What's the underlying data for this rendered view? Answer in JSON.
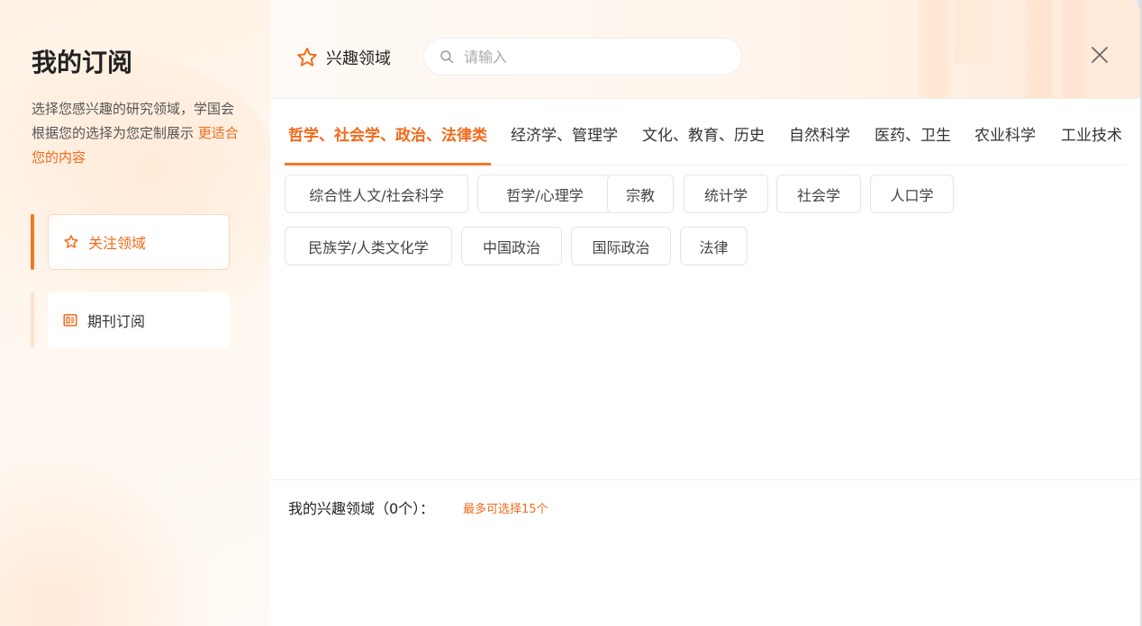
{
  "sidebar": {
    "title": "我的订阅",
    "desc": "选择您感兴趣的研究领域，学国会根据您的选择为您定制展示",
    "desc_highlight": "更适合您的内容",
    "items": [
      {
        "label": "关注领域",
        "icon": "star-icon"
      },
      {
        "label": "期刊订阅",
        "icon": "journal-icon"
      }
    ]
  },
  "header": {
    "title": "兴趣领域",
    "icon": "star-icon",
    "search_placeholder": "请输入"
  },
  "tabs": [
    {
      "label": "哲学、社会学、政治、法律类"
    },
    {
      "label": "经济学、管理学"
    },
    {
      "label": "文化、教育、历史"
    },
    {
      "label": "自然科学"
    },
    {
      "label": "医药、卫生"
    },
    {
      "label": "农业科学"
    },
    {
      "label": "工业技术"
    }
  ],
  "chips": [
    {
      "label": "综合性人文/社会科学"
    },
    {
      "label": "哲学/心理学"
    },
    {
      "label": "宗教"
    },
    {
      "label": "统计学"
    },
    {
      "label": "社会学"
    },
    {
      "label": "人口学"
    },
    {
      "label": "民族学/人类文化学"
    },
    {
      "label": "中国政治"
    },
    {
      "label": "国际政治"
    },
    {
      "label": "法律"
    }
  ],
  "footer": {
    "my_interests": "我的兴趣领域（0个）：",
    "hint": "最多可选择15个"
  },
  "colors": {
    "accent": "#f26a1b",
    "accent_soft": "#ffd6bb"
  }
}
